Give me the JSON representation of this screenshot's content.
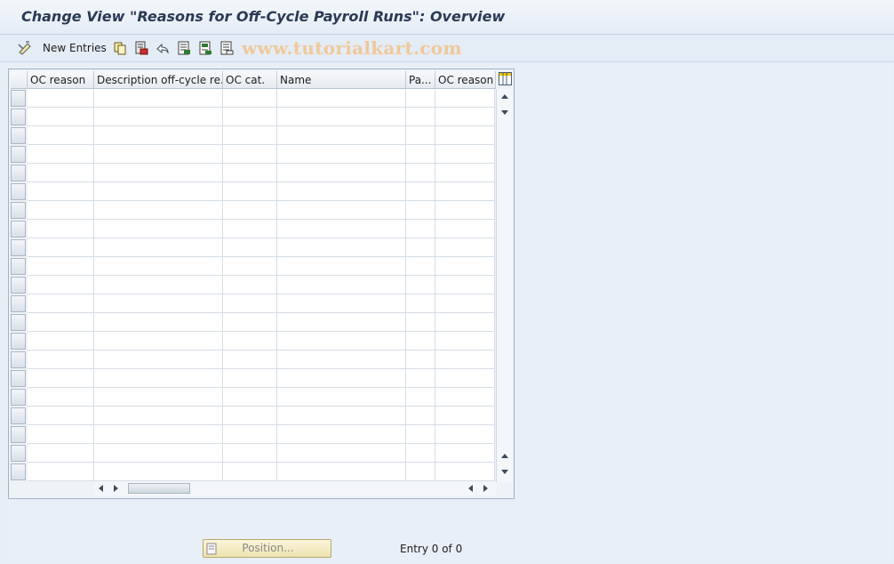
{
  "window": {
    "title": "Change View \"Reasons for Off-Cycle Payroll Runs\": Overview"
  },
  "toolbar": {
    "new_entries_label": "New Entries",
    "icons": [
      "display-change-icon",
      "copy-icon",
      "delete-icon",
      "undo-icon",
      "select-all-icon",
      "select-block-icon",
      "deselect-all-icon"
    ],
    "watermark": "www.tutorialkart.com"
  },
  "table": {
    "columns": [
      "OC reason",
      "Description off-cycle re...",
      "OC cat.",
      "Name",
      "Pa...",
      "OC reason ty"
    ],
    "visible_rows": 21,
    "rows": []
  },
  "footer": {
    "position_button_label": "Position...",
    "entry_info": "Entry 0 of 0"
  },
  "colors": {
    "title_text": "#2a3a55",
    "watermark": "#f0c89a",
    "position_button_bg": "#f3e9bd"
  }
}
